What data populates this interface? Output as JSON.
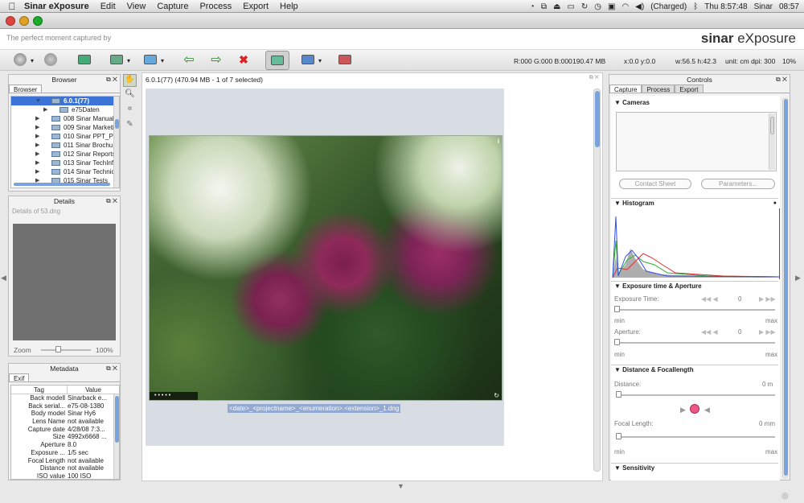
{
  "menubar": {
    "app": "Sinar eXposure",
    "items": [
      "Edit",
      "View",
      "Capture",
      "Process",
      "Export",
      "Help"
    ],
    "battery": "(Charged)",
    "clock": "Thu 8:57:48",
    "user": "Sinar",
    "time": "08:57"
  },
  "header": {
    "tagline": "The perfect moment captured by",
    "brand_bold": "sinar",
    "brand_rest": " eXposure"
  },
  "toolbar": {
    "rgb": "R:000 G:000 B:000",
    "mem": "190.47 MB",
    "xy": "x:0.0 y:0.0",
    "wh": "w:56.5 h:42.3",
    "unit": "unit: cm dpi: 300",
    "zoom": "10%"
  },
  "browser": {
    "title": "Browser",
    "tab": "Browser",
    "items": [
      {
        "label": "6.0.1(77)",
        "sel": true,
        "arrow": "▼"
      },
      {
        "label": "e75Daten",
        "arrow": "▶",
        "indent": true
      },
      {
        "label": "008 Sinar Manuals",
        "arrow": "▶"
      },
      {
        "label": "009 Sinar Marketi",
        "arrow": "▶"
      },
      {
        "label": "010 Sinar PPT_Pre",
        "arrow": "▶"
      },
      {
        "label": "011 Sinar Brochu",
        "arrow": "▶"
      },
      {
        "label": "012 Sinar Reports",
        "arrow": "▶"
      },
      {
        "label": "013 Sinar TechInf",
        "arrow": "▶"
      },
      {
        "label": "014 Sinar Technic",
        "arrow": "▶"
      },
      {
        "label": "015 Sinar Tests",
        "arrow": "▶"
      }
    ]
  },
  "details": {
    "title": "Details",
    "file": "Details of 53.dng",
    "zoom_label": "Zoom",
    "zoom_value": "100%"
  },
  "metadata": {
    "title": "Metadata",
    "tab": "Exif",
    "col_tag": "Tag",
    "col_value": "Value",
    "rows": [
      [
        "Back modell",
        "Sinarback e..."
      ],
      [
        "Back serial...",
        "e75-08-1380"
      ],
      [
        "Body model",
        "Sinar Hy6"
      ],
      [
        "Lens Name",
        "not available"
      ],
      [
        "Capture date",
        "4/28/08 7:3..."
      ],
      [
        "Size",
        "4992x6668 ..."
      ],
      [
        "Aperture",
        "8.0"
      ],
      [
        "Exposure ...",
        "1/5 sec"
      ],
      [
        "Focal Length",
        "not available"
      ],
      [
        "Distance",
        "not available"
      ],
      [
        "ISO value",
        "100 ISO"
      ]
    ]
  },
  "viewer": {
    "status": "6.0.1(77) (470.94 MB - 1 of 7 selected)",
    "filename": "<date>_<projectname>_<enumeration>.<extension>_1.dng",
    "info_icon": "i"
  },
  "controls": {
    "title": "Controls",
    "tabs": [
      "Capture",
      "Process",
      "Export"
    ],
    "cameras": "Cameras",
    "contact_sheet": "Contact Sheet",
    "parameters": "Parameters...",
    "histogram": "Histogram",
    "exposure_section": "Exposure time & Aperture",
    "exposure_time": "Exposure Time:",
    "exposure_value": "0",
    "aperture": "Aperture:",
    "aperture_value": "0",
    "min": "min",
    "max": "max",
    "distance_section": "Distance & Focallength",
    "distance": "Distance:",
    "distance_value": "0 m",
    "focal": "Focal Length:",
    "focal_value": "0 mm",
    "sensitivity": "Sensitivity"
  },
  "colors": {
    "accent": "#3b74d6",
    "histogram_red": "#e03030",
    "histogram_green": "#30b030",
    "histogram_blue": "#3050e0"
  }
}
